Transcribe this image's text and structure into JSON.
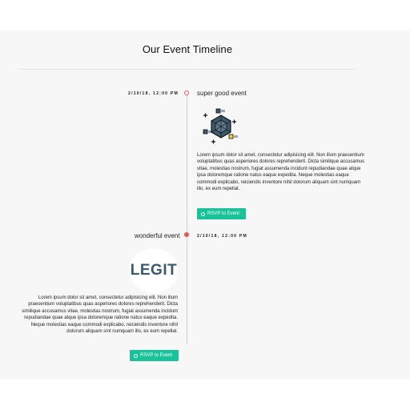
{
  "header": {
    "title": "Our Event Timeline"
  },
  "events": [
    {
      "date": "2/10/18, 12:00 PM",
      "title": "super good event",
      "icon": "hexagon-network-icon",
      "description": "Lorem ipsum dolor sit amet, consectetur adipisicing elit. Non illum praesentium voluptatibus quas asperiores dolores reprehenderit. Dicta similique accusamus vitae, molestias nostrum, fugiat assumenda incidunt repudiandae quae atque ipsa doloremque ratione natus eaque expedita. Neque molestias eaque commodi explicabo, reiciendis inventore nihil dolorum aliquam sint numquam illo, ex eum repellat.",
      "button_label": "RSVP to Event"
    },
    {
      "date": "2/10/18, 12:00 PM",
      "title": "wonderful event",
      "badge_text": "LEGIT",
      "description": "Lorem ipsum dolor sit amet, consectetur adipisicing elit. Non illum praesentium voluptatibus quas asperiores dolores reprehenderit. Dicta similique accusamus vitae, molestias nostrum, fugiat assumenda incidunt repudiandae quae atque ipsa doloremque ratione natus eaque expedita. Neque molestias eaque commodi explicabo, reiciendis inventore nihil dolorum aliquam sint numquam illo, ex eum repellat.",
      "button_label": "RSVP to Event"
    }
  ],
  "colors": {
    "accent_button": "#19c39a",
    "timeline_dot": "#e05a5a",
    "badge_text": "#3d5a6c"
  }
}
